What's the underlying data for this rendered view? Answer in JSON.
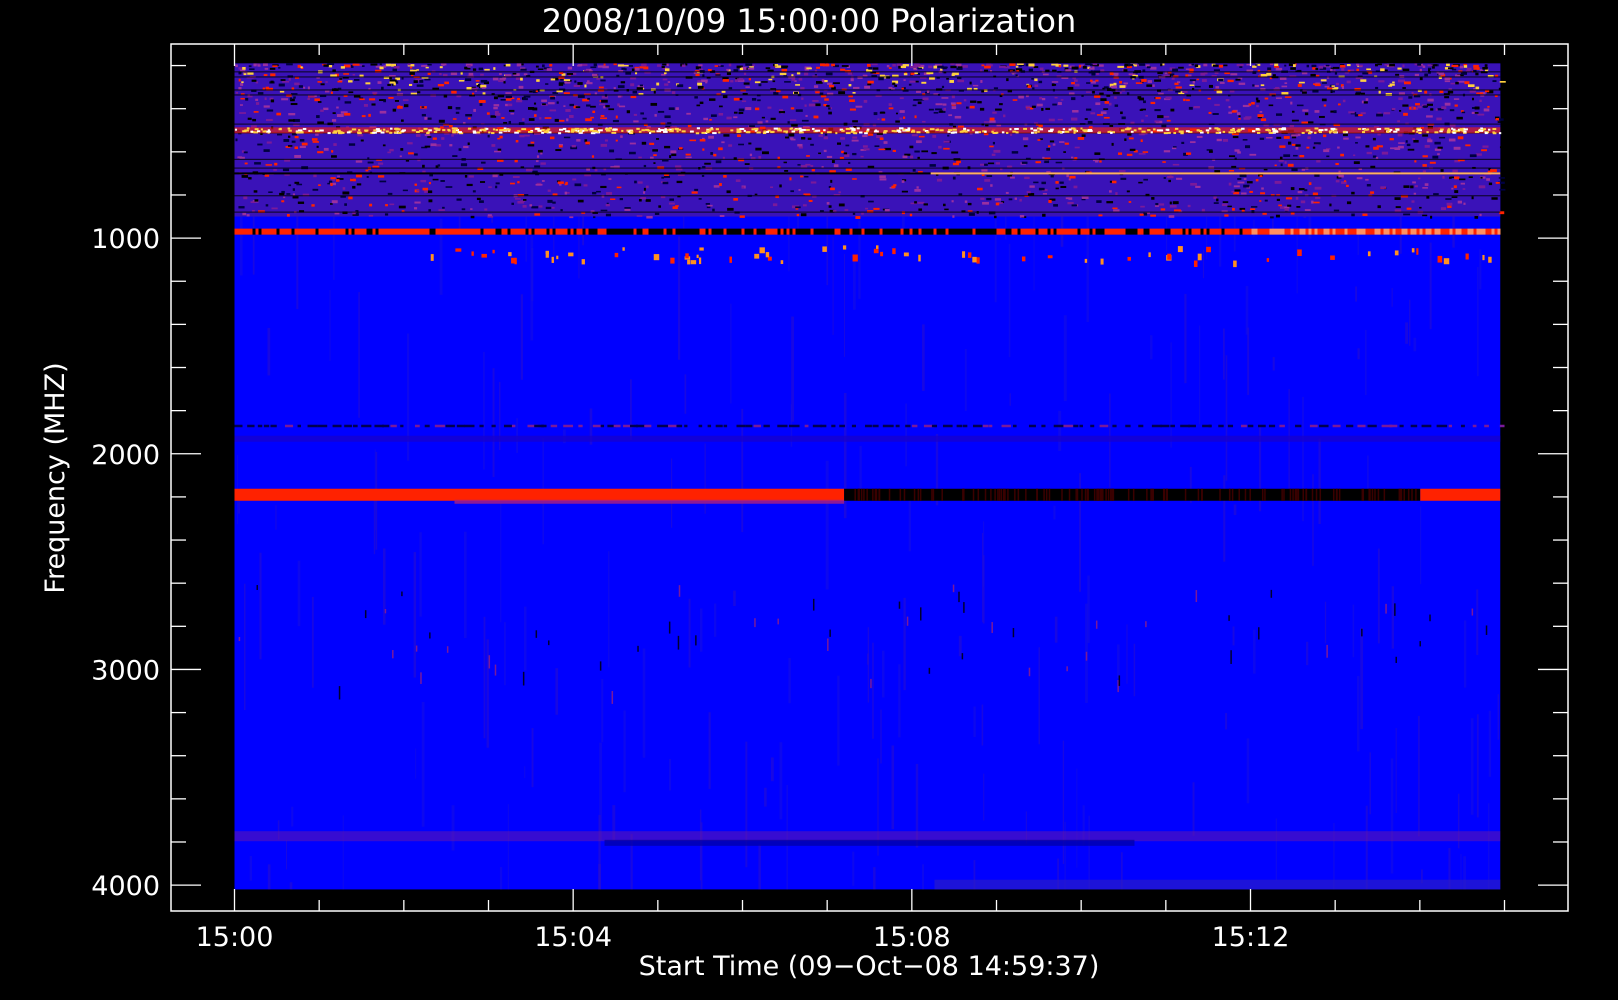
{
  "chart_data": {
    "type": "heatmap",
    "title": "2008/10/09 15:00:00 Polarization",
    "xlabel": "Start Time (09−Oct−08 14:59:37)",
    "ylabel": "Frequency (MHZ)",
    "x_ticks": [
      "15:00",
      "15:04",
      "15:08",
      "15:12"
    ],
    "x_tick_values_min": [
      0,
      4,
      8,
      12
    ],
    "x_range_min": [
      -0.75,
      15.75
    ],
    "y_ticks": [
      "1000",
      "2000",
      "3000",
      "4000"
    ],
    "y_tick_values": [
      1000,
      2000,
      3000,
      4000
    ],
    "y_range": [
      100,
      4120
    ],
    "y_inverted": true,
    "data_x_range_min": [
      0,
      14.95
    ],
    "data_y_range": [
      190,
      4020
    ],
    "colors": {
      "background": "#0000ff",
      "weak": "#7a1a9a",
      "moderate": "#ff2200",
      "strong": "#ffd040",
      "negative": "#000000",
      "frame": "#ffffff"
    },
    "features": [
      {
        "freq_range": [
          190,
          900
        ],
        "kind": "noise-speckle"
      },
      {
        "freq": 500,
        "kind": "bright-band"
      },
      {
        "freq": 700,
        "kind": "dark-line"
      },
      {
        "freq": 970,
        "kind": "band",
        "dark_span_min": [
          4,
          9
        ]
      },
      {
        "freq": 1050,
        "kind": "dashes"
      },
      {
        "freq": 1870,
        "kind": "dark-dashed-line"
      },
      {
        "freq": 2190,
        "kind": "strong-band",
        "flip_at_min": 7.2
      }
    ]
  }
}
